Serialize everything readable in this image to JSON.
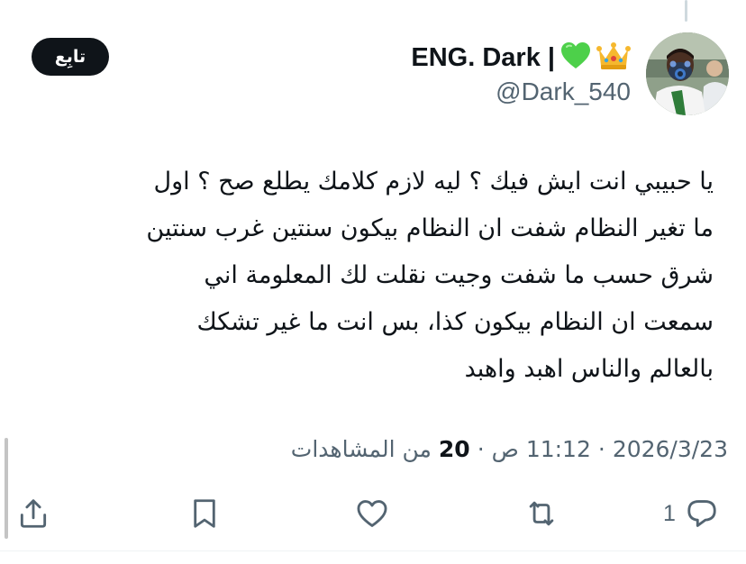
{
  "author": {
    "display_name": "ENG. Dark |",
    "handle": "@Dark_540",
    "name_emojis": [
      "green-heart-icon",
      "crown-icon"
    ]
  },
  "follow_button": {
    "label": "تابِع"
  },
  "tweet": {
    "text_lines": [
      "يا حبيبي انت ايش فيك ؟ ليه لازم كلامك يطلع صح ؟ اول",
      "ما تغير النظام شفت ان النظام بيكون سنتين غرب سنتين",
      "شرق حسب ما شفت وجيت نقلت لك المعلومة اني",
      "سمعت ان النظام بيكون كذا، بس انت ما غير تشكك",
      "بالعالم والناس اهبد واهبد"
    ]
  },
  "meta": {
    "date": "2026/3/23",
    "time": "11:12 ص",
    "views_count": "20",
    "views_label": "من المشاهدات",
    "separator": "·"
  },
  "actions": {
    "reply_count": "1",
    "icons": [
      "reply-icon",
      "retweet-icon",
      "like-icon",
      "bookmark-icon",
      "share-icon"
    ]
  },
  "colors": {
    "text_primary": "#0f1419",
    "text_secondary": "#536471",
    "follow_bg": "#0f1419",
    "follow_text": "#ffffff",
    "divider": "#eff3f4"
  }
}
